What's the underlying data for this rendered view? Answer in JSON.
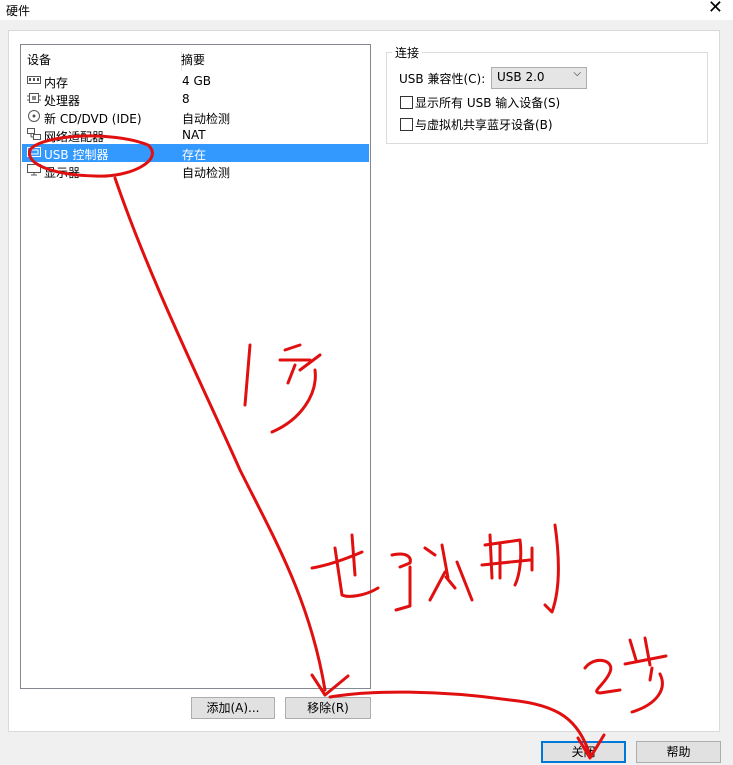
{
  "window": {
    "title": "硬件"
  },
  "device_list": {
    "headers": {
      "device": "设备",
      "summary": "摘要"
    },
    "rows": [
      {
        "label": "内存",
        "value": "4 GB",
        "icon": "memory-icon"
      },
      {
        "label": "处理器",
        "value": "8",
        "icon": "cpu-icon"
      },
      {
        "label": "新 CD/DVD (IDE)",
        "value": "自动检测",
        "icon": "cd-icon"
      },
      {
        "label": "网络适配器",
        "value": "NAT",
        "icon": "network-icon"
      },
      {
        "label": "USB 控制器",
        "value": "存在",
        "icon": "usb-icon",
        "selected": true
      },
      {
        "label": "显示器",
        "value": "自动检测",
        "icon": "display-icon"
      }
    ]
  },
  "buttons": {
    "add": "添加(A)...",
    "remove": "移除(R)",
    "close": "关闭",
    "help": "帮助"
  },
  "connection": {
    "group_title": "连接",
    "compat_label": "USB 兼容性(C):",
    "compat_value": "USB 2.0",
    "show_all_label": "显示所有 USB 输入设备(S)",
    "share_bt_label": "与虚拟机共享蓝牙设备(B)"
  },
  "colors": {
    "selection": "#3399ff",
    "annotation": "#e01010"
  }
}
